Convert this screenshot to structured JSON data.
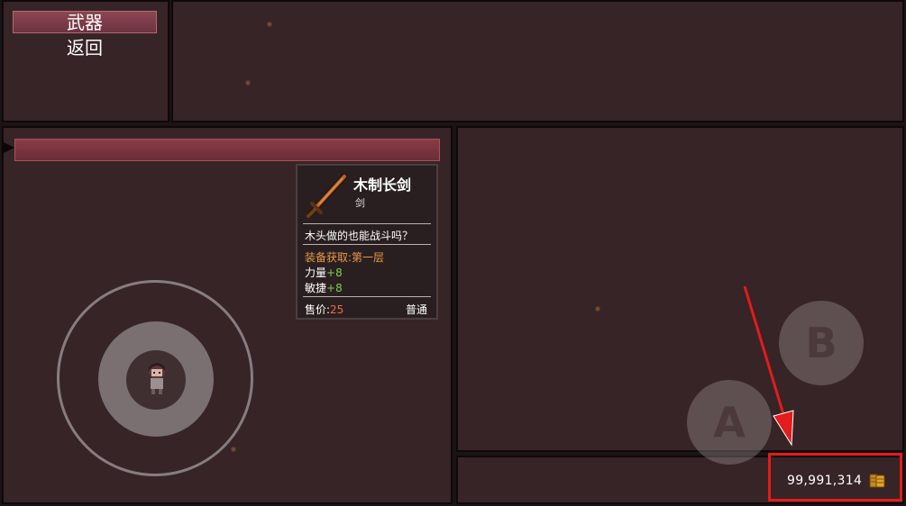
{
  "menu": {
    "items": [
      {
        "label": "武器",
        "selected": true
      },
      {
        "label": "返回",
        "selected": false
      }
    ]
  },
  "tooltip": {
    "name": "木制长剑",
    "type": "剑",
    "description": "木头做的也能战斗吗？",
    "source_label": "装备获取:",
    "source_value": "第一层",
    "stats": [
      {
        "label": "力量",
        "value": "+8"
      },
      {
        "label": "敏捷",
        "value": "+8"
      }
    ],
    "price_label": "售价:",
    "price_value": "25",
    "rarity": "普通",
    "icon": "wooden-sword-icon"
  },
  "controls": {
    "button_a": "A",
    "button_b": "B"
  },
  "gold": {
    "amount": "99,991,314",
    "icon": "gold-coins-icon"
  },
  "colors": {
    "selected_bar": "#8c4752",
    "source_text": "#e79a48",
    "stat_bonus": "#7bd34a",
    "price_value": "#f26b48",
    "highlight_box": "#e31c1c"
  }
}
